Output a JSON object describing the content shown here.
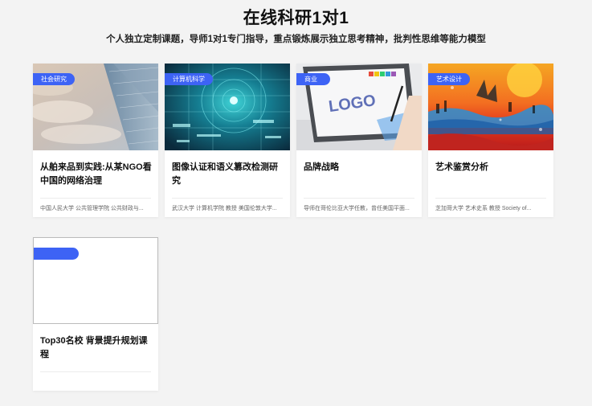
{
  "header": {
    "title": "在线科研1对1",
    "subtitle": "个人独立定制课题，导师1对1专门指导，重点锻炼展示独立思考精神，批判性思维等能力模型"
  },
  "colors": {
    "accent": "#3d63f5",
    "background": "#f3f3f3"
  },
  "cards": [
    {
      "badge": "社会研究",
      "title": "从舶来品到实践:从某NGO看中国的网络治理",
      "meta": "中国人民大学 公共管理学院 公共财政与..."
    },
    {
      "badge": "计算机科学",
      "title": "图像认证和语义篡改检测研究",
      "meta": "武汉大学 计算机学院 教授 美国伦敦大学..."
    },
    {
      "badge": "商业",
      "title": "品牌战略",
      "meta": "导师在哥伦比亚大学任教，曾任美国平面..."
    },
    {
      "badge": "艺术设计",
      "title": "艺术鉴赏分析",
      "meta": "芝加哥大学 艺术史系 教授 Society of..."
    },
    {
      "badge": "",
      "title": "Top30名校 背景提升规划课程",
      "meta": ""
    }
  ]
}
